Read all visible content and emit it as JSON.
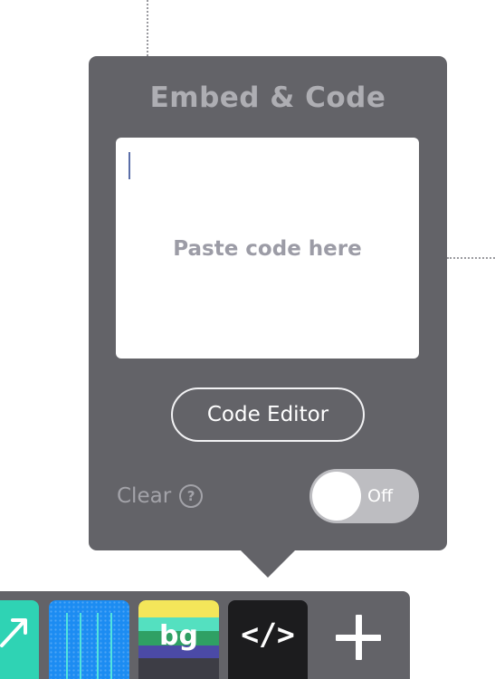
{
  "popover": {
    "title": "Embed & Code",
    "placeholder": "Paste code here",
    "code_editor_label": "Code Editor",
    "clear_label": "Clear",
    "help_glyph": "?",
    "toggle": {
      "state_label": "Off",
      "on": false
    }
  },
  "toolbar": {
    "items": [
      {
        "icon": "arrow-icon",
        "color": "#2fd3b4"
      },
      {
        "icon": "lines-icon",
        "color": "#1c8cf2"
      },
      {
        "icon": "background-icon",
        "label": "bg"
      },
      {
        "icon": "code-icon",
        "label": "</>",
        "selected": true
      },
      {
        "icon": "plus-icon"
      }
    ]
  },
  "colors": {
    "popover_bg": "#636368",
    "toolbar_bg": "#636368",
    "toggle_track": "#bdbdc1",
    "caret": "#5b6ea8"
  }
}
